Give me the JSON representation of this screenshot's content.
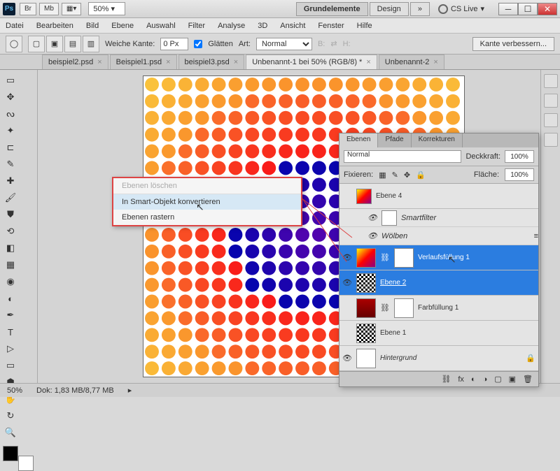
{
  "title_bar": {
    "ps": "Ps",
    "br": "Br",
    "mb": "Mb",
    "zoom": "50%",
    "ws_active": "Grundelemente",
    "ws_design": "Design",
    "more": "»",
    "cslive": "CS Live"
  },
  "menu": [
    "Datei",
    "Bearbeiten",
    "Bild",
    "Ebene",
    "Auswahl",
    "Filter",
    "Analyse",
    "3D",
    "Ansicht",
    "Fenster",
    "Hilfe"
  ],
  "options": {
    "soft_edge_label": "Weiche Kante:",
    "soft_edge_val": "0 Px",
    "smooth": "Glätten",
    "style_label": "Art:",
    "style_val": "Normal",
    "b": "B:",
    "h": "H:",
    "refine": "Kante verbessern..."
  },
  "tabs": [
    {
      "label": "beispiel2.psd",
      "active": false
    },
    {
      "label": "Beispiel1.psd",
      "active": false
    },
    {
      "label": "beispiel3.psd",
      "active": false
    },
    {
      "label": "Unbenannt-1 bei 50% (RGB/8) *",
      "active": true
    },
    {
      "label": "Unbenannt-2",
      "active": false
    }
  ],
  "context": {
    "disabled": "Ebenen löschen",
    "hover": "In Smart-Objekt konvertieren",
    "item2": "Ebenen rastern"
  },
  "layers_panel": {
    "tabs": [
      "Ebenen",
      "Pfade",
      "Korrekturen"
    ],
    "blend": "Normal",
    "opacity_label": "Deckkraft:",
    "opacity": "100%",
    "lock_label": "Fixieren:",
    "fill_label": "Fläche:",
    "fill": "100%",
    "layers": [
      {
        "name": "Ebene 4",
        "type": "img"
      },
      {
        "name": "Smartfilter",
        "type": "sub",
        "sub": "Wölben"
      },
      {
        "name": "Verlaufsfüllung 1",
        "type": "fill-grad",
        "sel": true
      },
      {
        "name": "Ebene 2",
        "type": "patt",
        "sel": true,
        "u": true
      },
      {
        "name": "Farbfüllung 1",
        "type": "fill-red"
      },
      {
        "name": "Ebene 1",
        "type": "patt2"
      },
      {
        "name": "Hintergrund",
        "type": "bg",
        "italic": true
      }
    ]
  },
  "status": {
    "zoom": "50%",
    "doc": "Dok: 1,83 MB/8,77 MB"
  }
}
